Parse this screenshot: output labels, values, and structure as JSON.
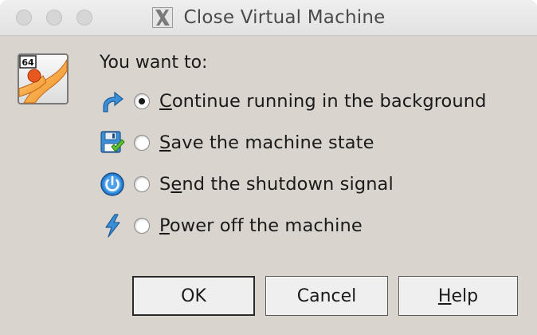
{
  "window": {
    "title": "Close Virtual Machine"
  },
  "dialog": {
    "prompt": "You want to:",
    "options": [
      {
        "mnemonic": "C",
        "rest": "ontinue running in the background",
        "selected": true,
        "icon": "continue-arrow-icon"
      },
      {
        "mnemonic": "S",
        "rest": "ave the machine state",
        "selected": false,
        "icon": "save-state-icon"
      },
      {
        "pre": "S",
        "mnemonic": "e",
        "rest": "nd the shutdown signal",
        "selected": false,
        "icon": "power-button-icon"
      },
      {
        "mnemonic": "P",
        "rest": "ower off the machine",
        "selected": false,
        "icon": "lightning-icon"
      }
    ],
    "app_icon": {
      "badge": "64",
      "name": "virtualbox-vm-icon"
    }
  },
  "buttons": {
    "ok": "OK",
    "cancel": "Cancel",
    "help_mnemonic": "H",
    "help_rest": "elp"
  },
  "colors": {
    "background": "#d9d5ce",
    "orange": "#f39a2a",
    "blue": "#2a82d6"
  }
}
